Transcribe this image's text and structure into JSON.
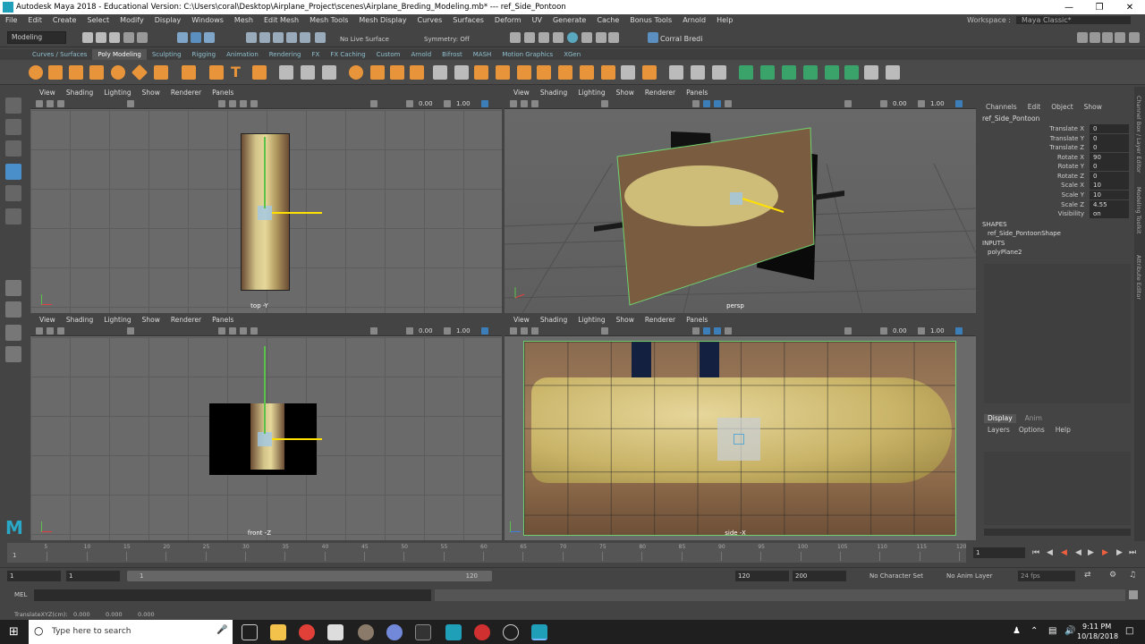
{
  "title_bar": {
    "title": "Autodesk Maya 2018 - Educational Version: C:\\Users\\coral\\Desktop\\Airplane_Project\\scenes\\Airplane_Breding_Modeling.mb*   ---   ref_Side_Pontoon"
  },
  "menus": [
    "File",
    "Edit",
    "Create",
    "Select",
    "Modify",
    "Display",
    "Windows",
    "Mesh",
    "Edit Mesh",
    "Mesh Tools",
    "Mesh Display",
    "Curves",
    "Surfaces",
    "Deform",
    "UV",
    "Generate",
    "Cache",
    "Bonus Tools",
    "Arnold",
    "Help"
  ],
  "workspace": {
    "label": "Workspace :",
    "value": "Maya Classic*"
  },
  "status_line": {
    "mode": "Modeling",
    "live_surface": "No Live Surface",
    "symmetry": "Symmetry: Off",
    "user": "Corral Bredi"
  },
  "shelf_tabs": [
    "Curves / Surfaces",
    "Poly Modeling",
    "Sculpting",
    "Rigging",
    "Animation",
    "Rendering",
    "FX",
    "FX Caching",
    "Custom",
    "Arnold",
    "Bifrost",
    "MASH",
    "Motion Graphics",
    "XGen"
  ],
  "active_shelf": "Poly Modeling",
  "viewport_menu": [
    "View",
    "Shading",
    "Lighting",
    "Show",
    "Renderer",
    "Panels"
  ],
  "viewport_values": {
    "exposure": "0.00",
    "gamma": "1.00"
  },
  "viewports": [
    {
      "camera": "top -Y"
    },
    {
      "camera": "persp"
    },
    {
      "camera": "front -Z"
    },
    {
      "camera": "side -X"
    }
  ],
  "channel_box": {
    "menu": [
      "Channels",
      "Edit",
      "Object",
      "Show"
    ],
    "object": "ref_Side_Pontoon",
    "attributes": [
      {
        "name": "Translate X",
        "value": "0"
      },
      {
        "name": "Translate Y",
        "value": "0"
      },
      {
        "name": "Translate Z",
        "value": "0"
      },
      {
        "name": "Rotate X",
        "value": "90"
      },
      {
        "name": "Rotate Y",
        "value": "0"
      },
      {
        "name": "Rotate Z",
        "value": "0"
      },
      {
        "name": "Scale X",
        "value": "10"
      },
      {
        "name": "Scale Y",
        "value": "10"
      },
      {
        "name": "Scale Z",
        "value": "4.55"
      },
      {
        "name": "Visibility",
        "value": "on"
      }
    ],
    "shapes_header": "SHAPES",
    "shape": "ref_Side_PontoonShape",
    "inputs_header": "INPUTS",
    "input": "polyPlane2"
  },
  "layer_editor": {
    "tabs": [
      "Display",
      "Anim"
    ],
    "menu": [
      "Layers",
      "Options",
      "Help"
    ]
  },
  "side_strip_labels": [
    "Channel Box / Layer Editor",
    "Modeling Toolkit",
    "Attribute Editor"
  ],
  "time_slider": {
    "ticks": [
      "5",
      "10",
      "15",
      "20",
      "25",
      "30",
      "35",
      "40",
      "45",
      "50",
      "55",
      "60",
      "65",
      "70",
      "75",
      "80",
      "85",
      "90",
      "95",
      "100",
      "105",
      "110",
      "115",
      "120"
    ],
    "start_label": "1",
    "current_frame": "1"
  },
  "range_slider": {
    "start": "1",
    "anim_start": "1",
    "range_start": "1",
    "range_end": "120",
    "anim_end": "120",
    "end": "200",
    "character_set": "No Character Set",
    "anim_layer": "No Anim Layer",
    "fps": "24 fps"
  },
  "command_line": {
    "label": "MEL"
  },
  "help_line": {
    "label": "TranslateXYZ(cm):",
    "x": "0.000",
    "y": "0.000",
    "z": "0.000"
  },
  "taskbar": {
    "search_placeholder": "Type here to search",
    "time": "9:11 PM",
    "date": "10/18/2018"
  }
}
